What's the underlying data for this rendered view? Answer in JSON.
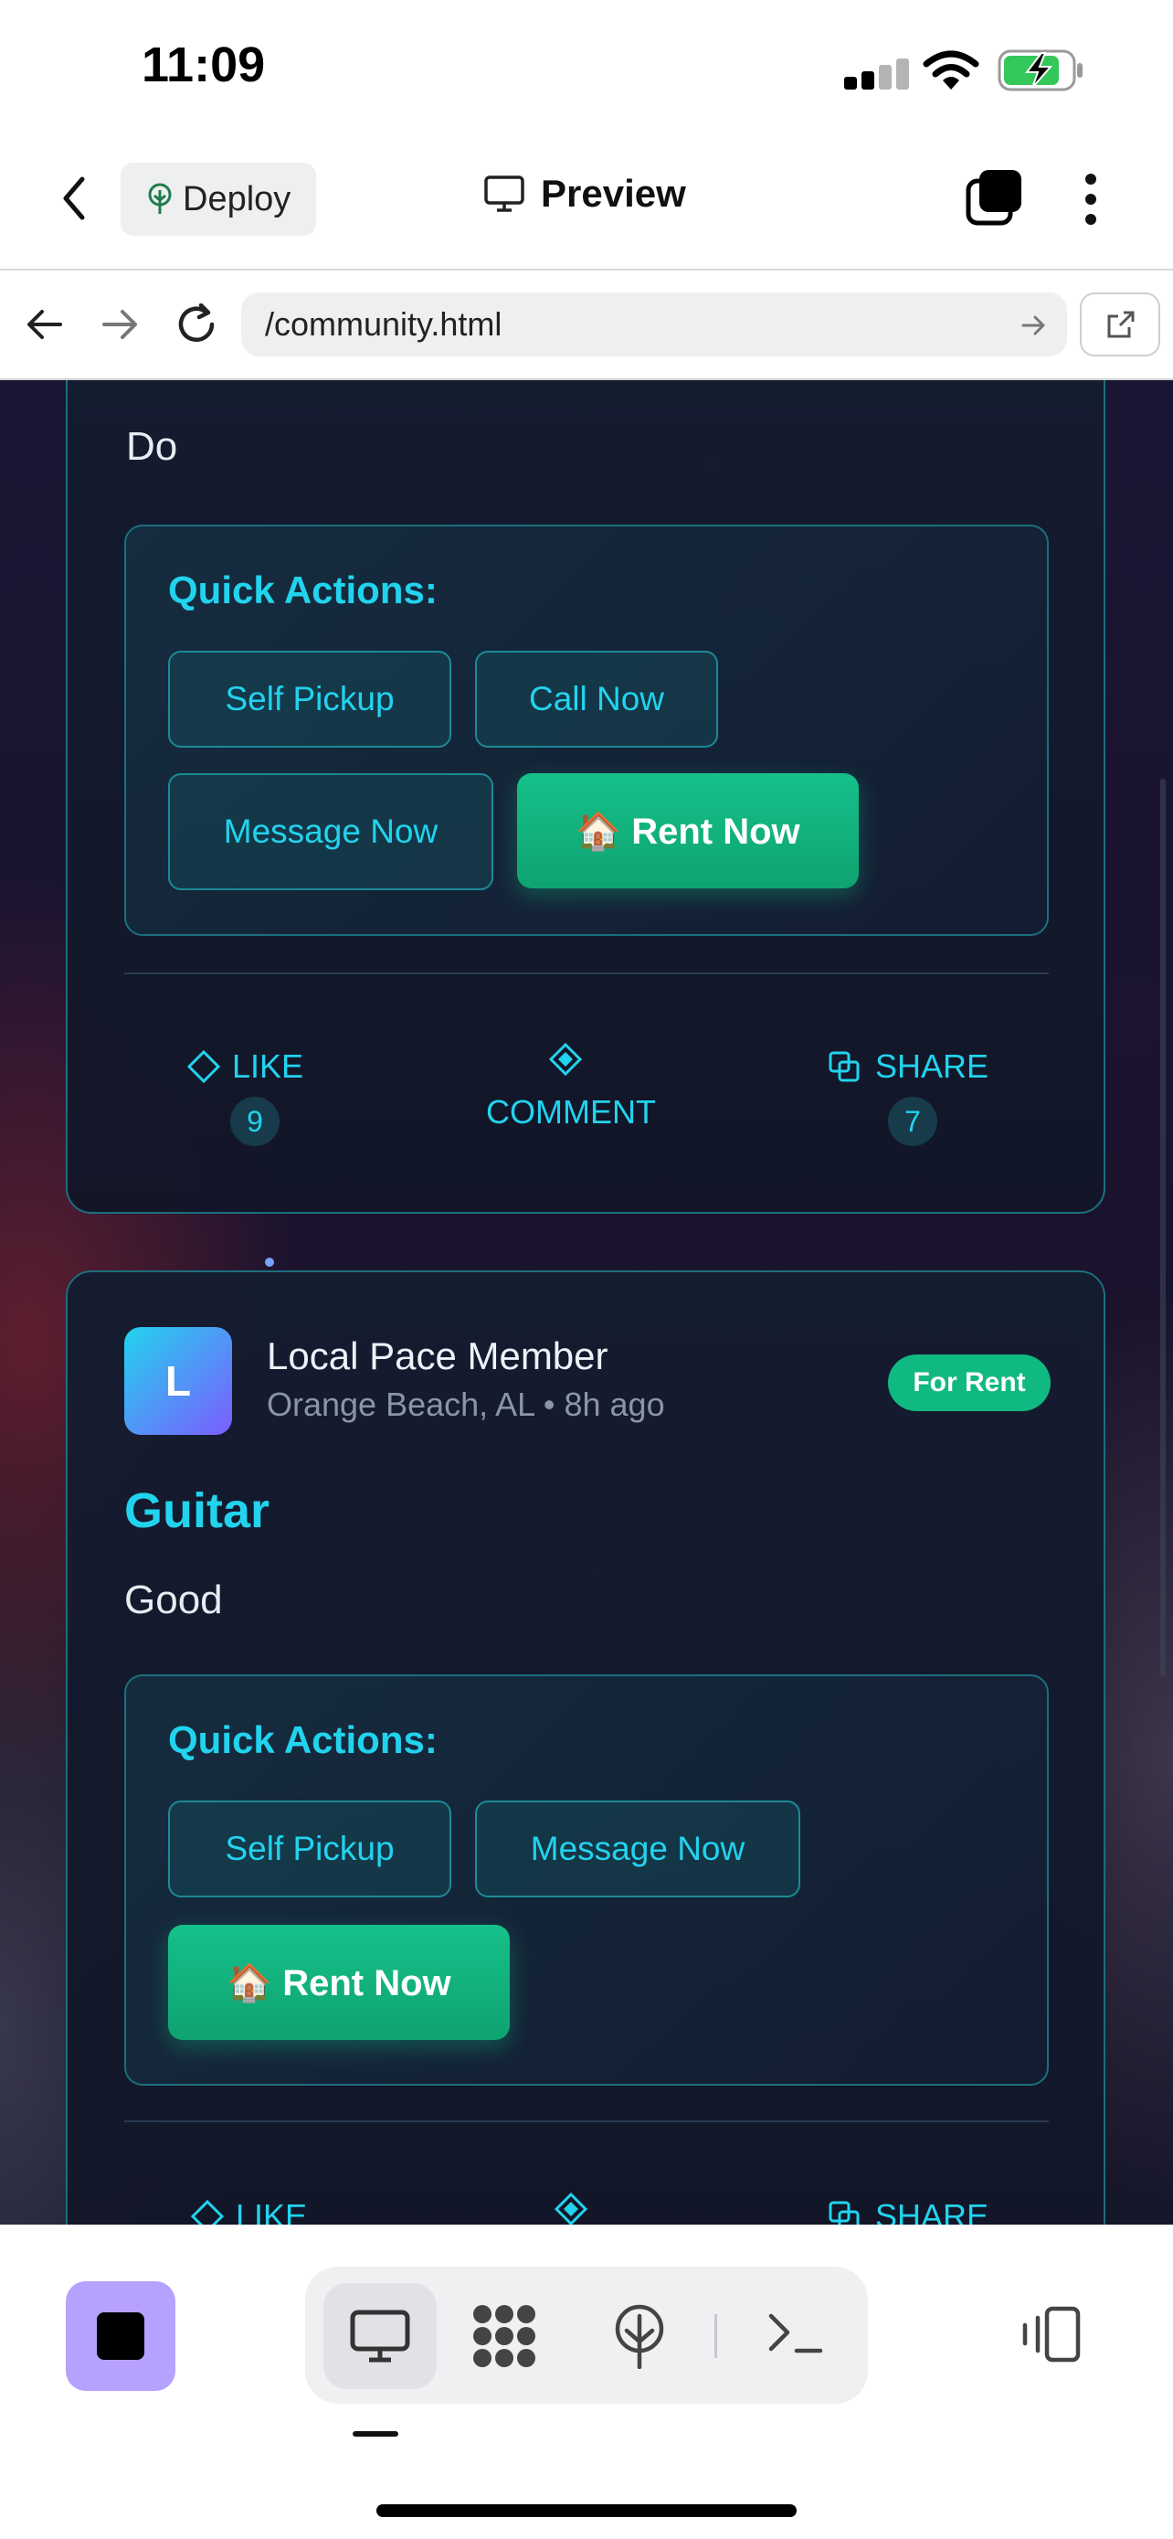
{
  "status_bar": {
    "time": "11:09"
  },
  "toolbar": {
    "deploy_label": "Deploy",
    "preview_label": "Preview"
  },
  "url_bar": {
    "url": "/community.html"
  },
  "post1": {
    "description": "Do",
    "quick_actions_title": "Quick Actions:",
    "buttons": [
      "Self Pickup",
      "Call Now",
      "Message Now"
    ],
    "rent_button": "🏠 Rent Now",
    "like_label": "LIKE",
    "like_count": "9",
    "comment_label": "COMMENT",
    "share_label": "SHARE",
    "share_count": "7"
  },
  "post2": {
    "avatar_letter": "L",
    "author": "Local Pace Member",
    "location_time": "Orange Beach, AL • 8h ago",
    "badge": "For Rent",
    "title": "Guitar",
    "description": "Good",
    "quick_actions_title": "Quick Actions:",
    "buttons": [
      "Self Pickup",
      "Message Now"
    ],
    "rent_button": "🏠 Rent Now",
    "like_label": "LIKE",
    "share_label": "SHARE"
  },
  "colors": {
    "accent": "#22d3ee",
    "rent_green": "#10b981",
    "stop_purple": "#b7a1ff"
  }
}
